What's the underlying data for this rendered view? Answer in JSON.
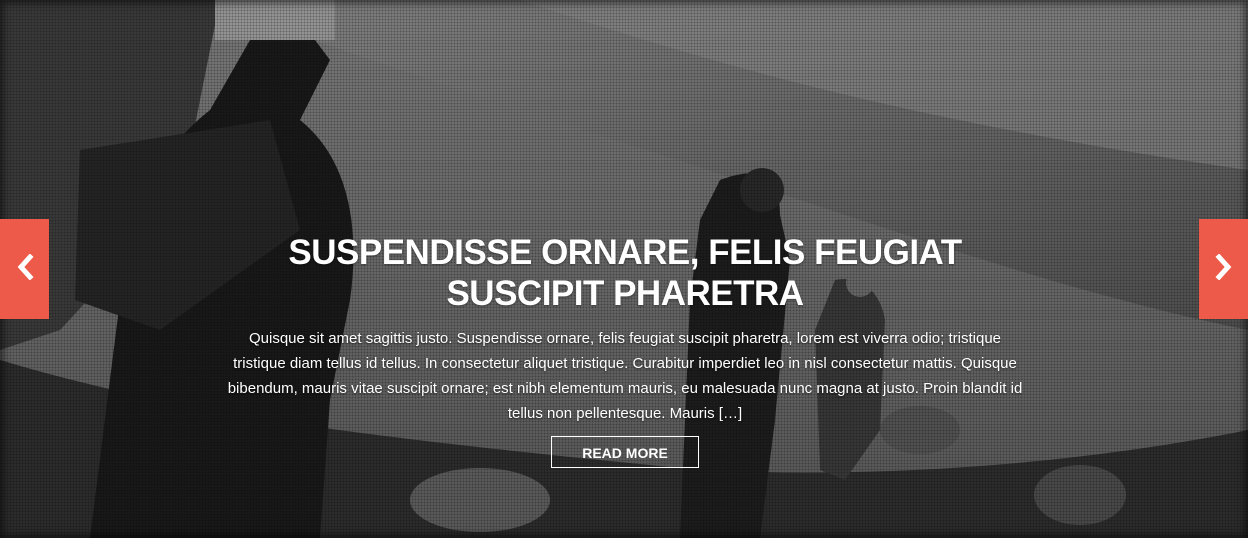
{
  "slide": {
    "title": "SUSPENDISSE ORNARE, FELIS FEUGIAT SUSCIPIT PHARETRA",
    "excerpt": "Quisque sit amet sagittis justo. Suspendisse ornare, felis feugiat suscipit pharetra, lorem est viverra odio; tristique tristique diam tellus id tellus. In consectetur aliquet tristique. Curabitur imperdiet leo in nisl consectetur mattis. Quisque bibendum, mauris vitae suscipit ornare; est nibh elementum mauris, eu malesuada nunc magna at justo. Proin blandit id tellus non pellentesque. Mauris […]",
    "read_more_label": "READ MORE"
  },
  "navigation": {
    "prev_icon": "chevron-left-icon",
    "next_icon": "chevron-right-icon",
    "accent_color": "#ed5a4a"
  }
}
